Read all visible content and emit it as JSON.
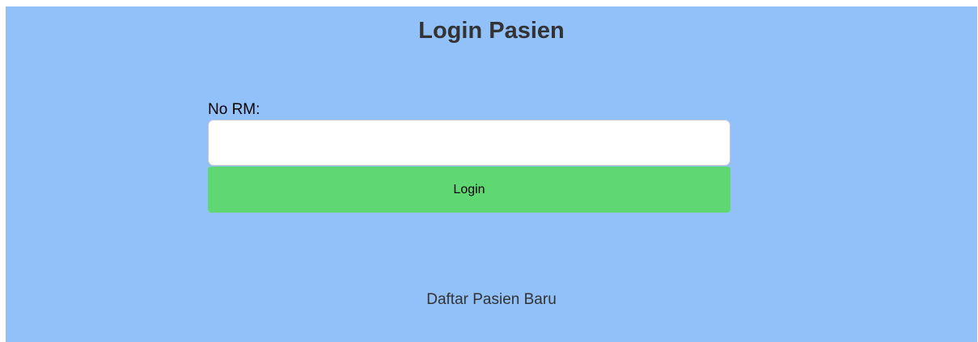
{
  "page": {
    "title": "Login Pasien"
  },
  "form": {
    "rm_label": "No RM:",
    "rm_value": "",
    "rm_placeholder": "",
    "login_label": "Login"
  },
  "footer": {
    "register_link": "Daftar Pasien Baru"
  },
  "colors": {
    "panel_background": "#92c0f8",
    "login_button": "#5fd873",
    "title_text": "#333333"
  }
}
